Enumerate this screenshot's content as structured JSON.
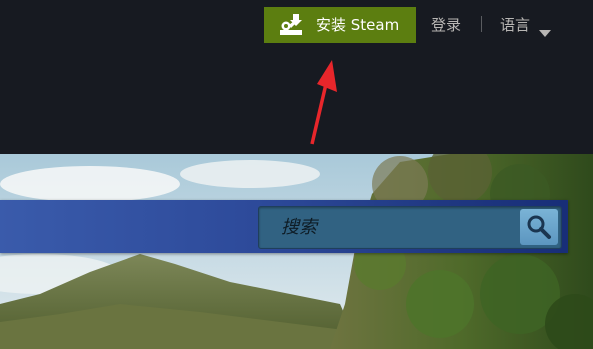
{
  "header": {
    "install_label": "安装 Steam",
    "login_label": "登录",
    "language_label": "语言"
  },
  "search": {
    "placeholder": "搜索"
  },
  "icons": {
    "install": "steam-install-icon",
    "caret": "caret-down-icon",
    "search": "magnifier-icon",
    "annotation": "red-arrow"
  },
  "colors": {
    "topbar_bg": "#171a21",
    "install_bg": "#5c7e10",
    "nav_band": "#2d4a9a",
    "search_bg": "#316282",
    "search_button": "#6fa8cf",
    "annotation_arrow": "#e8262b"
  }
}
